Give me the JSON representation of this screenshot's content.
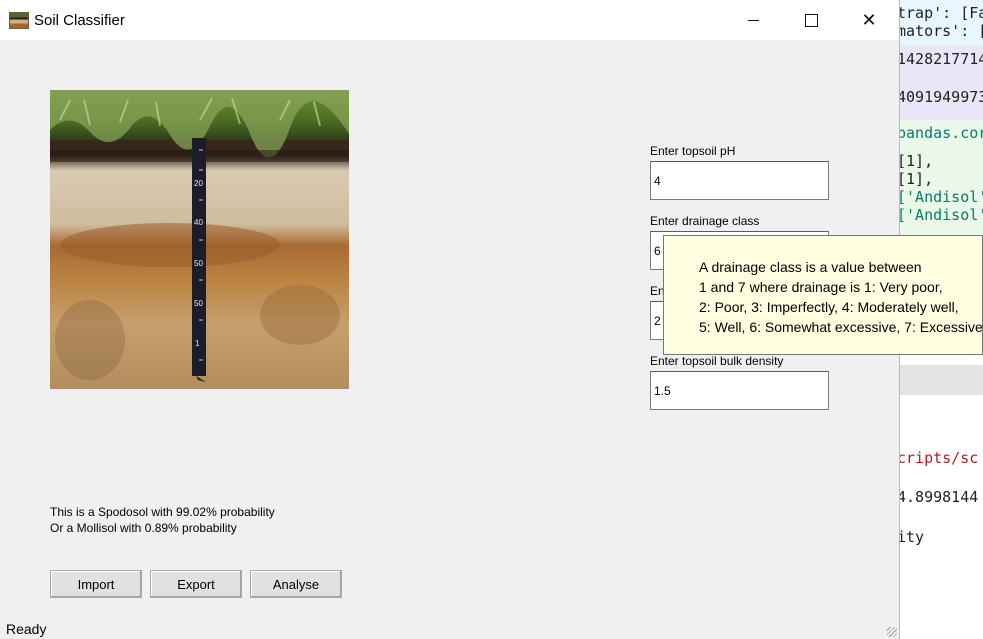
{
  "window": {
    "title": "Soil Classifier"
  },
  "background_editor": {
    "lines": [
      "trap': [Fa",
      "mators': [",
      "1428217714",
      "4091949973",
      "pandas.cor",
      "[1],",
      "[1],",
      "['Andisol'",
      "['Andisol'",
      "cripts/sc",
      "4.8998144",
      "ity"
    ]
  },
  "image": {
    "alt": "soil profile photo"
  },
  "result": {
    "line1": "This is a Spodosol with 99.02% probability",
    "line2": "Or a Mollisol with 0.89% probability"
  },
  "buttons": {
    "import": "Import",
    "export": "Export",
    "analyse": "Analyse"
  },
  "status": "Ready",
  "fields": {
    "ph": {
      "label": "Enter topsoil pH",
      "value": "4"
    },
    "drainage": {
      "label": "Enter drainage class",
      "value": "6"
    },
    "third": {
      "label": "En",
      "value": "2"
    },
    "bulk": {
      "label": "Enter topsoil bulk density",
      "value": "1.5"
    }
  },
  "tooltip": {
    "lines": [
      "A drainage class is a value between",
      "1 and 7 where drainage is 1: Very poor,",
      "2: Poor, 3: Imperfectly, 4: Moderately well,",
      "5: Well, 6: Somewhat excessive, 7: Excessive"
    ]
  },
  "ruler_marks": [
    "20",
    "40",
    "50",
    "50",
    "1"
  ]
}
